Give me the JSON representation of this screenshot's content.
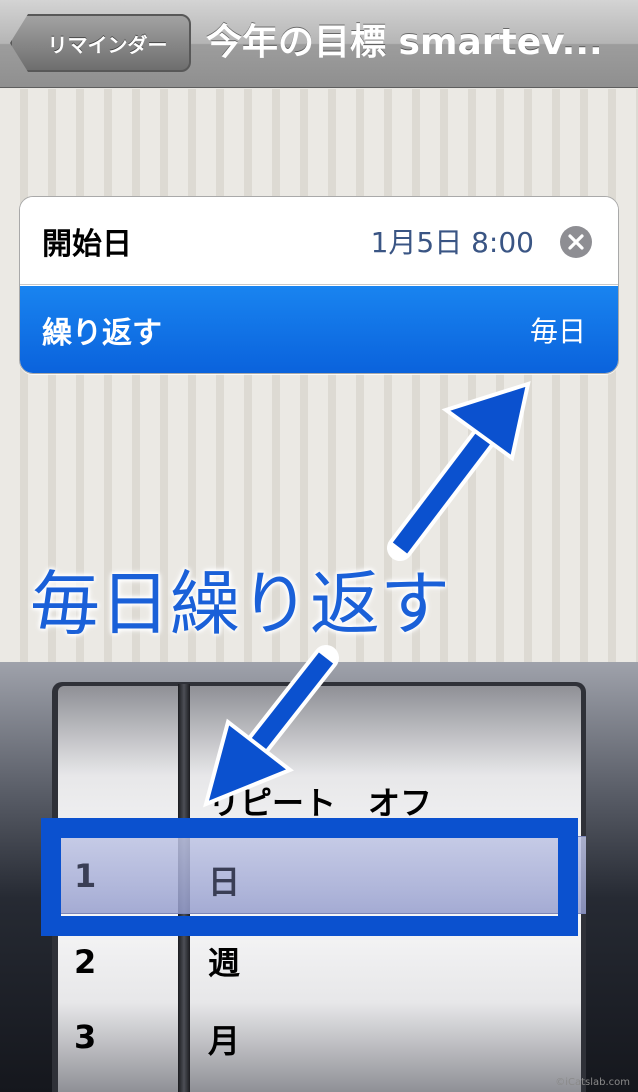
{
  "navbar": {
    "back_label": "リマインダー",
    "title": "今年の目標 smartev..."
  },
  "table": {
    "start": {
      "label": "開始日",
      "value": "1月5日 8:00"
    },
    "repeat": {
      "label": "繰り返す",
      "value": "毎日"
    }
  },
  "annotation": {
    "text": "毎日繰り返す"
  },
  "picker": {
    "left_wheel": {
      "selected": "1",
      "items_below": [
        "2",
        "3"
      ]
    },
    "right_wheel": {
      "item_above": "リピート　オフ",
      "selected": "日",
      "items_below": [
        "週",
        "月"
      ]
    }
  },
  "watermark": "©iCatslab.com",
  "colors": {
    "accent_blue": "#0a62dc",
    "annotation_blue": "#0b51cf",
    "value_text": "#3a5584"
  },
  "icons": [
    "clear-icon",
    "back-chevron"
  ]
}
